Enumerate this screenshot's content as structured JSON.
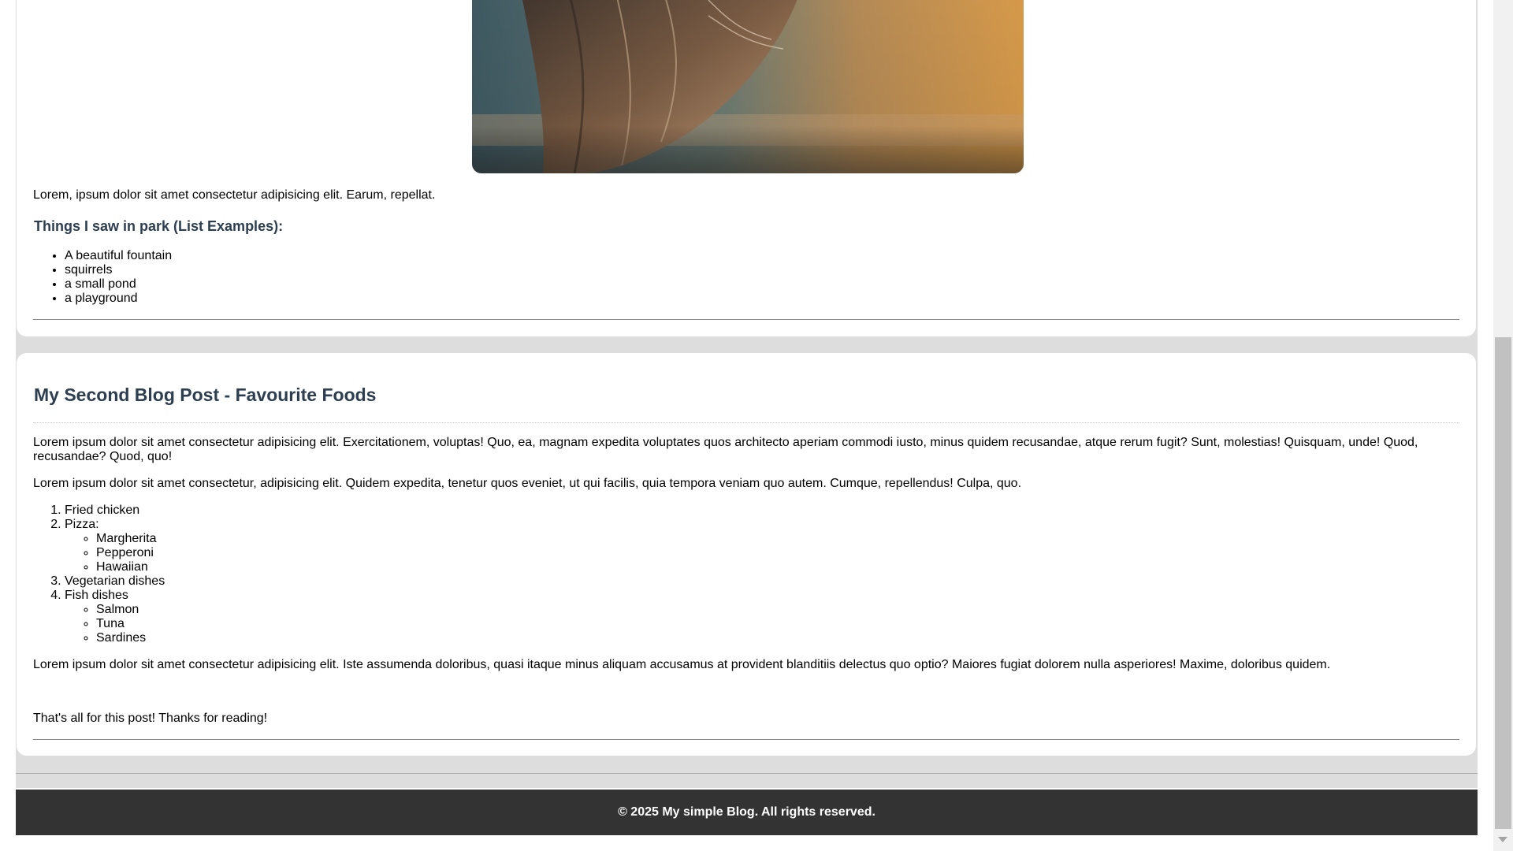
{
  "post1": {
    "paragraph": "Lorem, ipsum dolor sit amet consectetur adipisicing elit. Earum, repellat.",
    "list_heading": "Things I saw in park (List Examples):",
    "list_items": [
      "A beautiful fountain",
      "squirrels",
      "a small pond",
      "a playground"
    ]
  },
  "post2": {
    "title": "My Second Blog Post - Favourite Foods",
    "paragraph1": "Lorem ipsum dolor sit amet consectetur adipisicing elit. Exercitationem, voluptas! Quo, ea, magnam expedita voluptates quos architecto aperiam commodi iusto, minus quidem recusandae, atque rerum fugit? Sunt, molestias! Quisquam, unde! Quod, recusandae? Quod, quo!",
    "paragraph2": "Lorem ipsum dolor sit amet consectetur, adipisicing elit. Quidem expedita, tenetur quos eveniet, ut qui facilis, quia tempora veniam quo autem. Cumque, repellendus! Culpa, quo.",
    "foods": [
      {
        "label": "Fried chicken",
        "sub": []
      },
      {
        "label": "Pizza:",
        "sub": [
          "Margherita",
          "Pepperoni",
          "Hawaiian"
        ]
      },
      {
        "label": "Vegetarian dishes",
        "sub": []
      },
      {
        "label": "Fish dishes",
        "sub": [
          "Salmon",
          "Tuna",
          "Sardines"
        ]
      }
    ],
    "paragraph3": "Lorem ipsum dolor sit amet consectetur adipisicing elit. Iste assumenda doloribus, quasi itaque minus aliquam accusamus at provident blanditiis delectus quo optio? Maiores fugiat dolorem nulla asperiores! Maxime, doloribus quidem.",
    "closing": "That's all for this post! Thanks for reading!"
  },
  "footer": {
    "text": "© 2025 My simple Blog. All rights reserved."
  },
  "colors": {
    "heading": "#2c3e50",
    "page_background": "#dddddd",
    "footer_background": "#333333"
  }
}
